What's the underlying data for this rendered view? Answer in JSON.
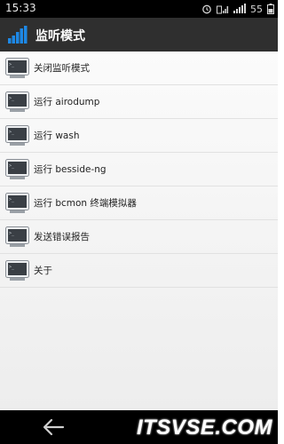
{
  "status": {
    "time": "15:33",
    "battery": "55"
  },
  "app": {
    "title": "监听模式"
  },
  "menu": [
    {
      "label": "关闭监听模式"
    },
    {
      "label": "运行 airodump"
    },
    {
      "label": "运行 wash"
    },
    {
      "label": "运行 besside-ng"
    },
    {
      "label": "运行 bcmon 终端模拟器"
    },
    {
      "label": "发送错误报告"
    },
    {
      "label": "关于"
    }
  ],
  "watermark": "ITSVSE.COM",
  "colors": {
    "action_bar": "#2f2f2f",
    "app_icon_blue": "#1e88e5",
    "status_bar": "#000000"
  }
}
